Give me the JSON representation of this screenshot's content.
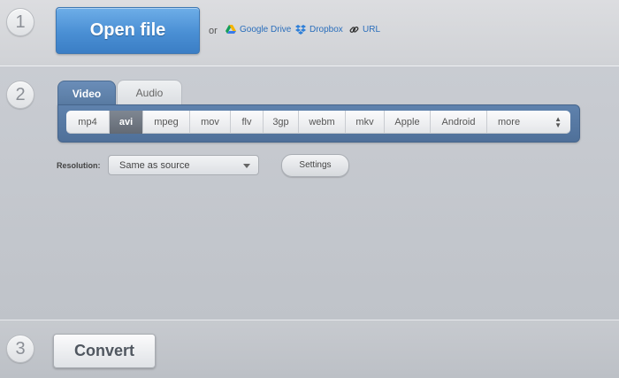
{
  "steps": {
    "one": "1",
    "two": "2",
    "three": "3"
  },
  "open": {
    "button_label": "Open file",
    "or_text": "or",
    "sources": [
      {
        "label": "Google Drive",
        "icon": "google-drive-icon"
      },
      {
        "label": "Dropbox",
        "icon": "dropbox-icon"
      },
      {
        "label": "URL",
        "icon": "link-icon"
      }
    ]
  },
  "tabs": [
    {
      "label": "Video",
      "active": true
    },
    {
      "label": "Audio",
      "active": false
    }
  ],
  "formats": [
    {
      "label": "mp4"
    },
    {
      "label": "avi",
      "selected": true
    },
    {
      "label": "mpeg"
    },
    {
      "label": "mov"
    },
    {
      "label": "flv"
    },
    {
      "label": "3gp"
    },
    {
      "label": "webm"
    },
    {
      "label": "mkv"
    },
    {
      "label": "Apple"
    },
    {
      "label": "Android"
    },
    {
      "label": "more",
      "icon": "up-down-arrows-icon"
    }
  ],
  "resolution": {
    "label": "Resolution:",
    "value": "Same as source"
  },
  "settings_label": "Settings",
  "convert_label": "Convert",
  "colors": {
    "accent": "#4a8fd4",
    "panel": "#5a7ca6",
    "link": "#2a6ebb"
  }
}
